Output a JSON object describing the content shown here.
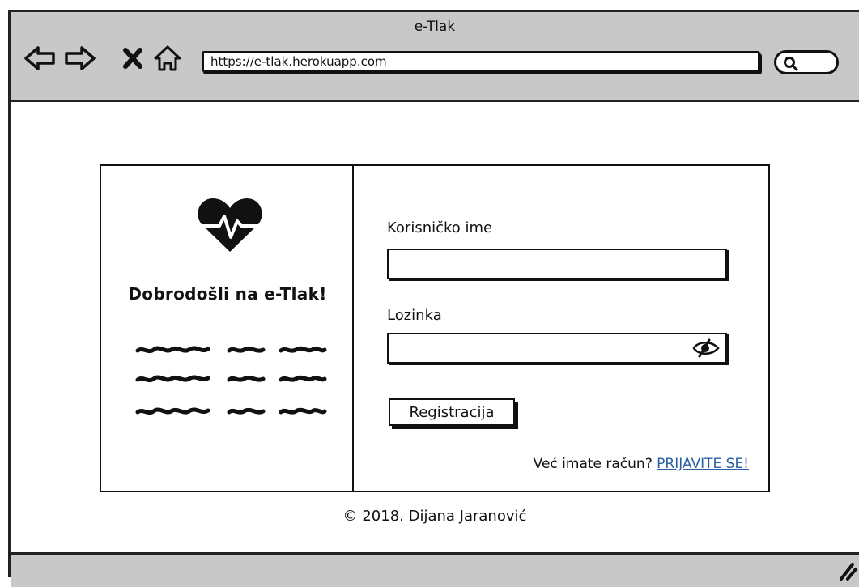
{
  "browser": {
    "title": "e-Tlak",
    "url": "https://e-tlak.herokuapp.com",
    "icons": [
      "back-arrow-icon",
      "forward-arrow-icon",
      "close-icon",
      "home-icon",
      "search-icon",
      "resize-grip-icon"
    ]
  },
  "welcome": {
    "logo_icon": "heartbeat-icon",
    "heading": "Dobrodošli na e-Tlak!"
  },
  "form": {
    "username_label": "Korisničko ime",
    "username_value": "",
    "password_label": "Lozinka",
    "password_value": "",
    "password_toggle_icon": "eye-hidden-icon",
    "register_button": "Registracija",
    "login_prompt": "Već imate račun?",
    "login_link": "PRIJAVITE SE!"
  },
  "footer": {
    "copyright": "© 2018. Dijana Jaranović"
  },
  "colors": {
    "chrome": "#c8c8c8",
    "link": "#2b5fa3"
  }
}
